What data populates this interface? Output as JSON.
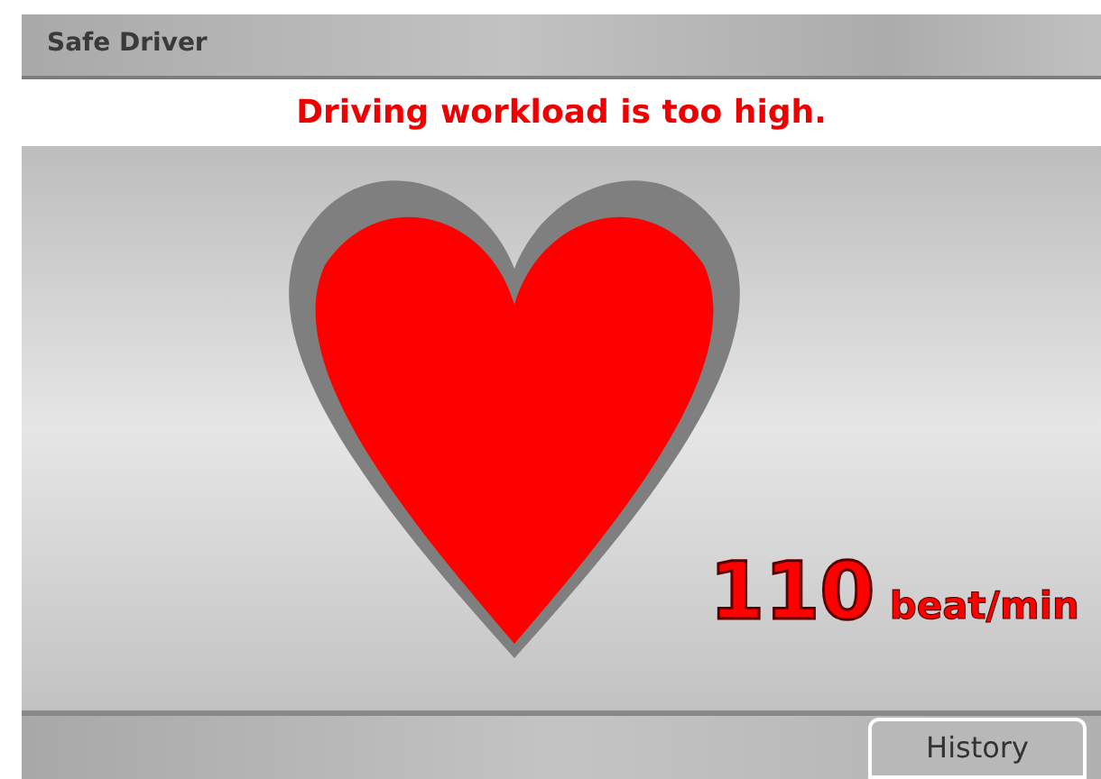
{
  "window": {
    "title": "Safe Driver"
  },
  "alert": "Driving workload is too high.",
  "heart_rate": {
    "value": "110",
    "unit": "beat/min"
  },
  "buttons": [
    "History"
  ]
}
